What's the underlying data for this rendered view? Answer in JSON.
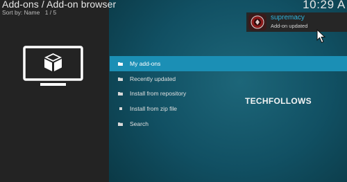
{
  "header": {
    "title": "Add-ons / Add-on browser",
    "sort_label": "Sort by: Name",
    "page_indicator": "1 / 5",
    "clock": "10:29 A"
  },
  "notification": {
    "title": "supremacy",
    "message": "Add-on updated"
  },
  "menu": {
    "items": [
      {
        "label": "My add-ons",
        "icon": "folder-icon"
      },
      {
        "label": "Recently updated",
        "icon": "folder-icon"
      },
      {
        "label": "Install from repository",
        "icon": "folder-icon"
      },
      {
        "label": "Install from zip file",
        "icon": "square-bullet-icon"
      },
      {
        "label": "Search",
        "icon": "folder-icon"
      }
    ],
    "selected_index": 0
  },
  "watermark": "TECHFOLLOWS",
  "colors": {
    "accent": "#1b8fb5",
    "left_panel": "#232323",
    "background": "#0f4a5b",
    "notification_title": "#2fb5dd"
  }
}
